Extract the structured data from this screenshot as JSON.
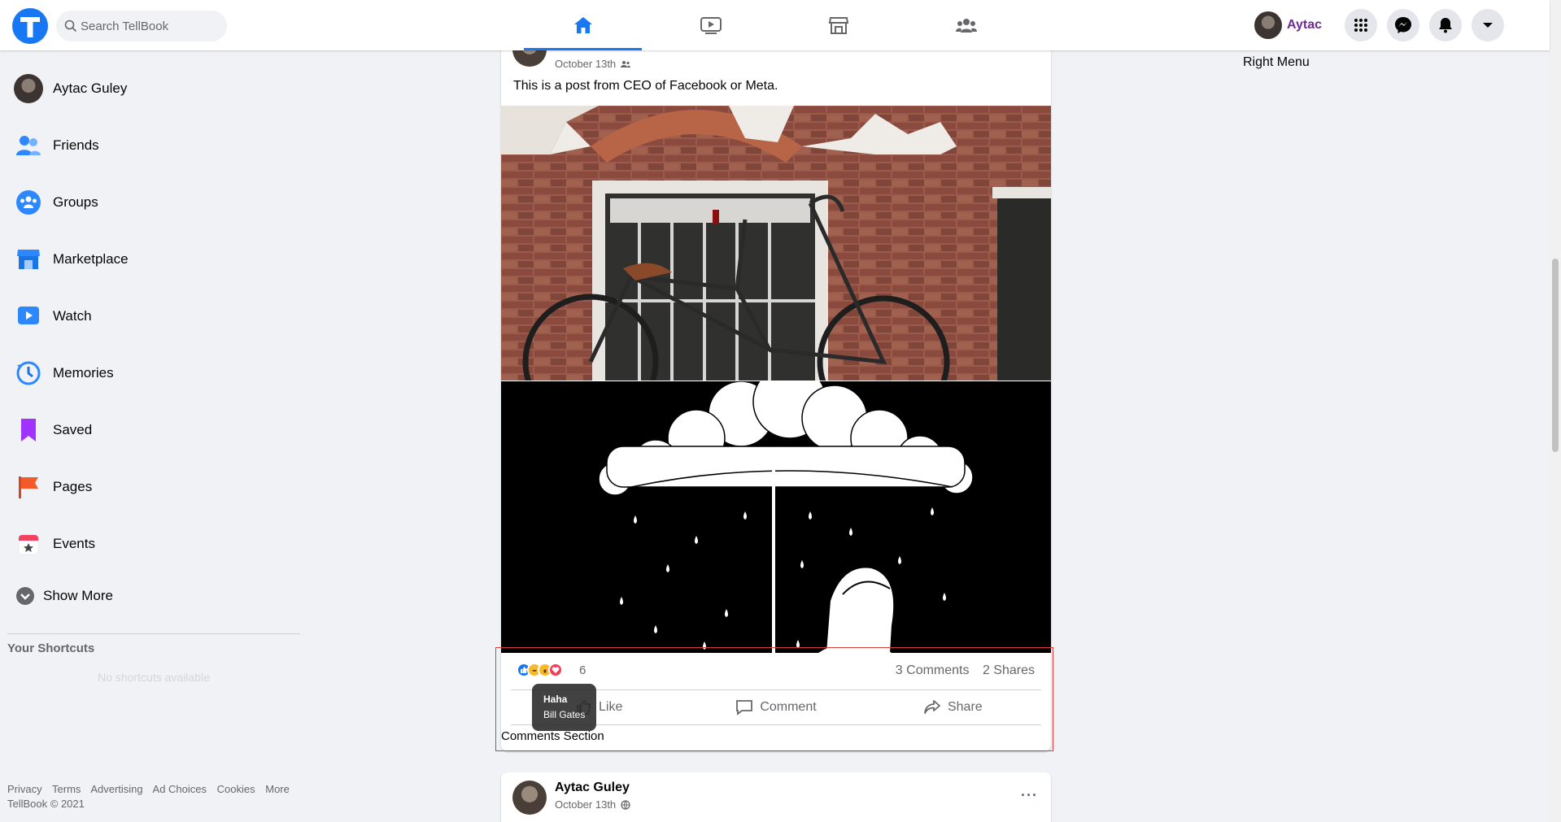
{
  "app": {
    "name": "TellBook",
    "brand_color": "#1877f2",
    "search_placeholder": "Search TellBook"
  },
  "nav": {
    "tabs": [
      {
        "name": "home",
        "icon": "home-icon",
        "active": true
      },
      {
        "name": "watch",
        "icon": "video-icon",
        "active": false
      },
      {
        "name": "marketplace",
        "icon": "store-icon",
        "active": false
      },
      {
        "name": "groups",
        "icon": "people-icon",
        "active": false
      }
    ]
  },
  "header_right": {
    "user_name": "Aytac",
    "user_name_color": "#6b2b8f",
    "buttons": [
      "menu-grid-icon",
      "messenger-icon",
      "bell-icon",
      "chevron-down-icon"
    ]
  },
  "sidebar": {
    "profile_name": "Aytac Guley",
    "items": [
      {
        "label": "Friends",
        "icon": "friends-icon"
      },
      {
        "label": "Groups",
        "icon": "groups-icon"
      },
      {
        "label": "Marketplace",
        "icon": "marketplace-icon"
      },
      {
        "label": "Watch",
        "icon": "watch-icon"
      },
      {
        "label": "Memories",
        "icon": "memories-icon"
      },
      {
        "label": "Saved",
        "icon": "saved-icon"
      },
      {
        "label": "Pages",
        "icon": "pages-icon"
      },
      {
        "label": "Events",
        "icon": "events-icon"
      }
    ],
    "show_more": "Show More",
    "shortcuts_title": "Your Shortcuts",
    "shortcuts_empty": "No shortcuts available"
  },
  "footer": {
    "links": [
      "Privacy",
      "Terms",
      "Advertising",
      "Ad Choices",
      "Cookies",
      "More"
    ],
    "copyright": "TellBook © 2021"
  },
  "post1": {
    "date": "October 13th",
    "text": "This is a post from CEO of Facebook or Meta.",
    "reaction_count": "6",
    "comments": "3 Comments",
    "shares": "2 Shares",
    "actions": {
      "like": "Like",
      "comment": "Comment",
      "share": "Share"
    },
    "comments_section": "Comments Section",
    "tooltip": {
      "reaction": "Haha",
      "user": "Bill Gates"
    }
  },
  "post2": {
    "author": "Aytac Guley",
    "date": "October 13th"
  },
  "right_menu": "Right Menu"
}
